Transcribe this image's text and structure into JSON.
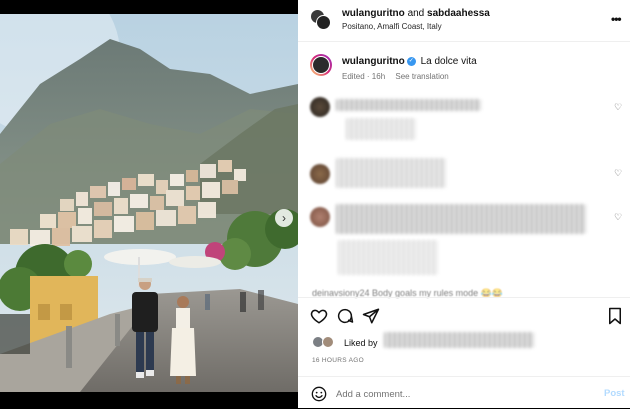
{
  "post_header": {
    "user1": "wulanguritno",
    "joiner": "and",
    "user2": "sabdaahessa",
    "location": "Positano, Amalfi Coast, Italy"
  },
  "caption": {
    "username": "wulanguritno",
    "text": "La dolce vita",
    "edited": "Edited · 16h",
    "translate": "See translation"
  },
  "comment_preview_tail": "deinavsiony24 Body goals my rules mode 😂😂",
  "actions": {
    "liked_by": "Liked by",
    "time_ago": "16 HOURS AGO"
  },
  "add_comment": {
    "placeholder": "Add a comment...",
    "post_label": "Post"
  },
  "carousel": {
    "total": 5,
    "active_index": 0
  },
  "colors": {
    "verified": "#3897f0",
    "post_disabled": "#b3dbff",
    "story_ring": "#d62976"
  },
  "icons": [
    "heart-icon",
    "comment-icon",
    "share-icon",
    "bookmark-icon",
    "emoji-icon",
    "more-icon",
    "chevron-right-icon"
  ]
}
